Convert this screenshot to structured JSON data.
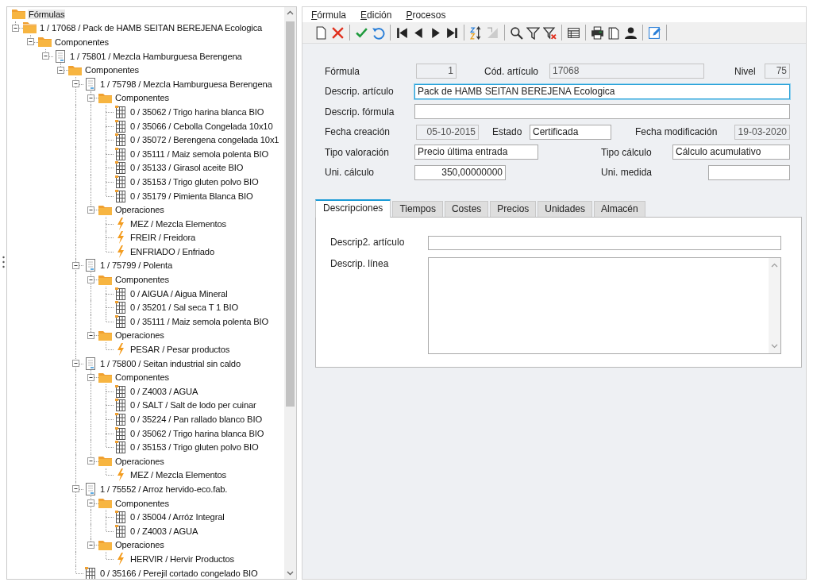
{
  "tree": {
    "title": "Fórmulas",
    "nodes": [
      {
        "label": "1 / 17068 / Pack de HAMB SEITAN BEREJENA Ecologica",
        "kind": "folder-stack",
        "expanded": true,
        "children": [
          {
            "label": "Componentes",
            "kind": "folder",
            "expanded": true,
            "children": [
              {
                "label": "1 / 75801 / Mezcla Hamburguesa Berengena",
                "kind": "formula",
                "expanded": true,
                "children": [
                  {
                    "label": "Componentes",
                    "kind": "folder",
                    "expanded": true,
                    "children": [
                      {
                        "label": "1 / 75798 / Mezcla Hamburguesa Berengena",
                        "kind": "formula",
                        "expanded": true,
                        "children": [
                          {
                            "label": "Componentes",
                            "kind": "folder",
                            "expanded": true,
                            "children": [
                              {
                                "label": "0 / 35062 / Trigo harina blanca BIO",
                                "kind": "component"
                              },
                              {
                                "label": "0 / 35066 / Cebolla Congelada 10x10",
                                "kind": "component"
                              },
                              {
                                "label": "0 / 35072 / Berengena congelada 10x1",
                                "kind": "component"
                              },
                              {
                                "label": "0 / 35111 / Maiz semola polenta BIO",
                                "kind": "component"
                              },
                              {
                                "label": "0 / 35133 / Girasol aceite BIO",
                                "kind": "component"
                              },
                              {
                                "label": "0 / 35153 / Trigo gluten polvo BIO",
                                "kind": "component"
                              },
                              {
                                "label": "0 / 35179 / Pimienta Blanca BIO",
                                "kind": "component"
                              }
                            ]
                          },
                          {
                            "label": "Operaciones",
                            "kind": "folder",
                            "expanded": true,
                            "children": [
                              {
                                "label": "MEZ / Mezcla Elementos",
                                "kind": "operation"
                              },
                              {
                                "label": "FREIR / Freidora",
                                "kind": "operation"
                              },
                              {
                                "label": "ENFRIADO / Enfriado",
                                "kind": "operation"
                              }
                            ]
                          }
                        ]
                      },
                      {
                        "label": "1 / 75799 / Polenta",
                        "kind": "formula",
                        "expanded": true,
                        "children": [
                          {
                            "label": "Componentes",
                            "kind": "folder",
                            "expanded": true,
                            "children": [
                              {
                                "label": "0 / AIGUA / Aigua Mineral",
                                "kind": "component"
                              },
                              {
                                "label": "0 / 35201 / Sal seca T 1 BIO",
                                "kind": "component"
                              },
                              {
                                "label": "0 / 35111 / Maiz semola polenta BIO",
                                "kind": "component"
                              }
                            ]
                          },
                          {
                            "label": "Operaciones",
                            "kind": "folder",
                            "expanded": true,
                            "children": [
                              {
                                "label": "PESAR / Pesar productos",
                                "kind": "operation"
                              }
                            ]
                          }
                        ]
                      },
                      {
                        "label": "1 / 75800 / Seitan industrial sin caldo",
                        "kind": "formula",
                        "expanded": true,
                        "children": [
                          {
                            "label": "Componentes",
                            "kind": "folder",
                            "expanded": true,
                            "children": [
                              {
                                "label": "0 / Z4003 / AGUA",
                                "kind": "component"
                              },
                              {
                                "label": "0 / SALT / Salt de lodo per cuinar",
                                "kind": "component"
                              },
                              {
                                "label": "0 / 35224 / Pan rallado blanco BIO",
                                "kind": "component"
                              },
                              {
                                "label": "0 / 35062 / Trigo harina blanca BIO",
                                "kind": "component"
                              },
                              {
                                "label": "0 / 35153 / Trigo gluten polvo BIO",
                                "kind": "component"
                              }
                            ]
                          },
                          {
                            "label": "Operaciones",
                            "kind": "folder",
                            "expanded": true,
                            "children": [
                              {
                                "label": "MEZ / Mezcla Elementos",
                                "kind": "operation"
                              }
                            ]
                          }
                        ]
                      },
                      {
                        "label": "1 / 75552 / Arroz hervido-eco.fab.",
                        "kind": "formula",
                        "expanded": true,
                        "children": [
                          {
                            "label": "Componentes",
                            "kind": "folder",
                            "expanded": true,
                            "children": [
                              {
                                "label": "0 / 35004 / Arróz Integral",
                                "kind": "component"
                              },
                              {
                                "label": "0 / Z4003 / AGUA",
                                "kind": "component"
                              }
                            ]
                          },
                          {
                            "label": "Operaciones",
                            "kind": "folder",
                            "expanded": true,
                            "children": [
                              {
                                "label": "HERVIR / Hervir Productos",
                                "kind": "operation"
                              }
                            ]
                          }
                        ]
                      },
                      {
                        "label": "0 / 35166 / Perejil cortado congelado BIO",
                        "kind": "component"
                      }
                    ]
                  }
                ]
              }
            ]
          }
        ]
      }
    ]
  },
  "menu": [
    "Fórmula",
    "Edición",
    "Procesos"
  ],
  "form": {
    "rows": [
      [
        {
          "label": "Fórmula",
          "value": "1",
          "kind": "number",
          "readonly": true,
          "focused": false
        },
        {
          "label": "Cód. artículo",
          "value": "17068",
          "kind": "text",
          "readonly": true,
          "focused": false
        },
        {
          "label": "Nivel",
          "value": "75",
          "kind": "number",
          "readonly": true,
          "focused": false
        }
      ],
      [
        {
          "label": "Descrip. artículo",
          "value": "Pack de HAMB SEITAN BEREJENA Ecologica",
          "kind": "text",
          "readonly": false,
          "focused": true
        }
      ],
      [
        {
          "label": "Descrip. fórmula",
          "kind": "text",
          "readonly": false,
          "focused": false
        }
      ],
      [
        {
          "label": "Fecha creación",
          "value": "05-10-2015",
          "kind": "number",
          "readonly": true,
          "focused": false
        },
        {
          "label": "Estado",
          "value": "Certificada",
          "kind": "text",
          "readonly": false,
          "focused": false
        },
        {
          "label": "Fecha modificación",
          "value": "19-03-2020",
          "kind": "number",
          "readonly": true,
          "focused": false
        }
      ],
      [
        {
          "label": "Tipo valoración",
          "value": "Precio última entrada",
          "kind": "text",
          "readonly": false,
          "focused": false
        },
        {
          "label": "Tipo cálculo",
          "value": "Cálculo acumulativo",
          "kind": "text",
          "readonly": false,
          "focused": false
        }
      ],
      [
        {
          "label": "Uni. cálculo",
          "value": "350,00000000",
          "kind": "number",
          "readonly": false,
          "focused": false
        },
        {
          "label": "Uni. medida",
          "kind": "text",
          "readonly": false,
          "focused": false
        }
      ]
    ]
  },
  "tabs": [
    {
      "label": "Descripciones",
      "selected": true
    },
    {
      "label": "Tiempos",
      "selected": false
    },
    {
      "label": "Costes",
      "selected": false
    },
    {
      "label": "Precios",
      "selected": false
    },
    {
      "label": "Unidades",
      "selected": false
    },
    {
      "label": "Almacén",
      "selected": false
    }
  ],
  "tab_fields": [
    {
      "label": "Descrip2. artículo",
      "kind": "line"
    },
    {
      "label": "Descrip. línea",
      "kind": "multiline"
    }
  ]
}
